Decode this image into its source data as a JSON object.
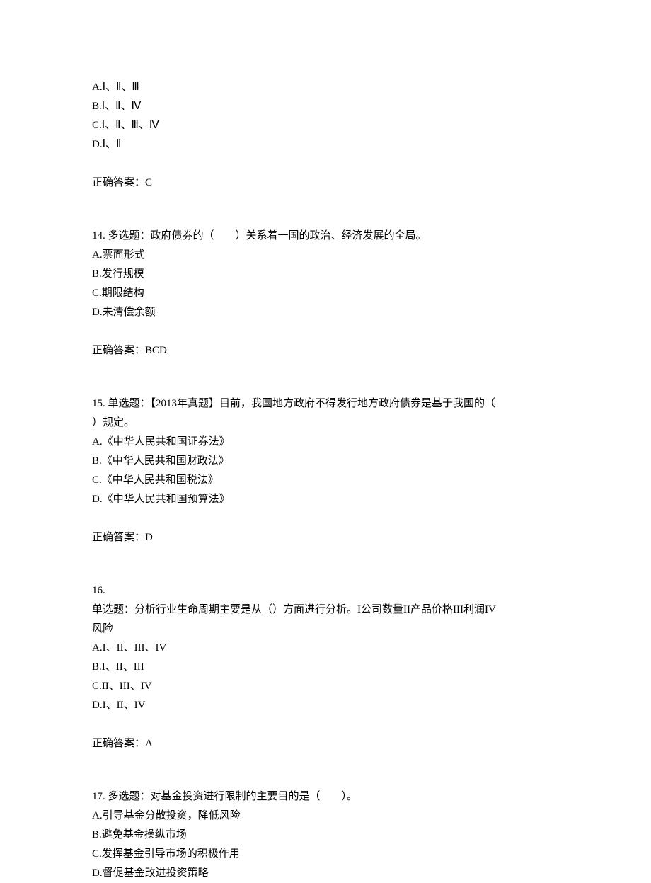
{
  "q13": {
    "options": {
      "a": "A.Ⅰ、Ⅱ、Ⅲ",
      "b": "B.Ⅰ、Ⅱ、Ⅳ",
      "c": "C.Ⅰ、Ⅱ、Ⅲ、Ⅳ",
      "d": "D.Ⅰ、Ⅱ"
    },
    "answer": "正确答案：C"
  },
  "q14": {
    "stem": "14. 多选题：政府债券的（　　）关系着一国的政治、经济发展的全局。",
    "options": {
      "a": "A.票面形式",
      "b": "B.发行规模",
      "c": "C.期限结构",
      "d": "D.未清偿余额"
    },
    "answer": "正确答案：BCD"
  },
  "q15": {
    "stem_line1": "15. 单选题：【2013年真题】目前，我国地方政府不得发行地方政府债券是基于我国的（",
    "stem_line2": "）规定。",
    "options": {
      "a": "A.《中华人民共和国证券法》",
      "b": "B.《中华人民共和国财政法》",
      "c": "C.《中华人民共和国税法》",
      "d": "D.《中华人民共和国预算法》"
    },
    "answer": "正确答案：D"
  },
  "q16": {
    "num": "16.",
    "stem_line1": "单选题：分析行业生命周期主要是从（）方面进行分析。I公司数量II产品价格III利润IV",
    "stem_line2": "风险",
    "options": {
      "a": "A.I、II、III、IV",
      "b": "B.I、II、III",
      "c": "C.II、III、IV",
      "d": "D.I、II、IV"
    },
    "answer": "正确答案：A"
  },
  "q17": {
    "stem": "17. 多选题：对基金投资进行限制的主要目的是（　　）。",
    "options": {
      "a": "A.引导基金分散投资，降低风险",
      "b": "B.避免基金操纵市场",
      "c": "C.发挥基金引导市场的积极作用",
      "d": "D.督促基金改进投资策略"
    }
  }
}
